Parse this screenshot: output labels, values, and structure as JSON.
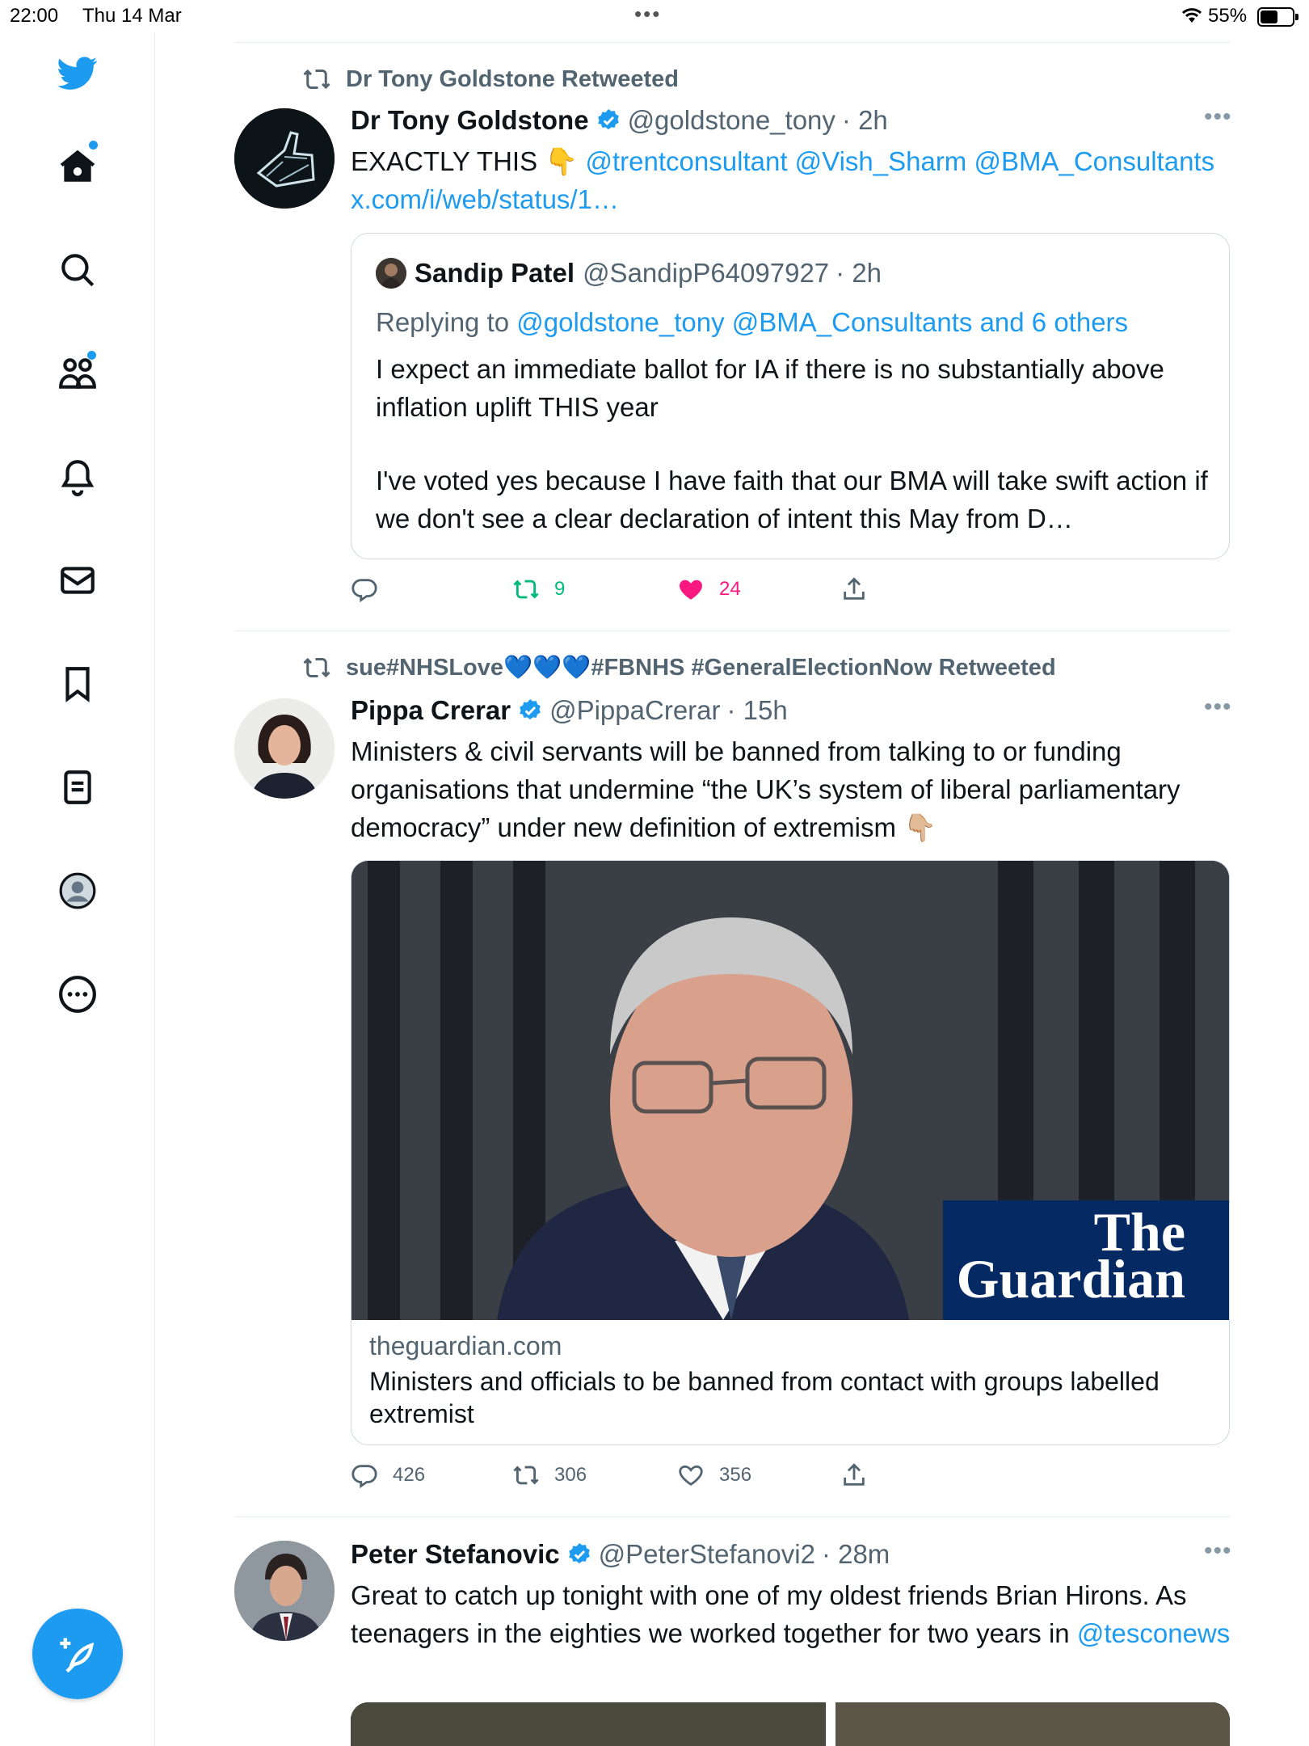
{
  "status_bar": {
    "time": "22:00",
    "date": "Thu 14 Mar",
    "battery": "55%",
    "battery_level": 0.55
  },
  "sidebar": {
    "items": [
      {
        "name": "home",
        "icon": "home-icon",
        "has_dot": true
      },
      {
        "name": "explore",
        "icon": "search-icon",
        "has_dot": false
      },
      {
        "name": "communities",
        "icon": "communities-icon",
        "has_dot": true
      },
      {
        "name": "notifications",
        "icon": "bell-icon",
        "has_dot": false
      },
      {
        "name": "messages",
        "icon": "envelope-icon",
        "has_dot": false
      },
      {
        "name": "bookmarks",
        "icon": "bookmark-icon",
        "has_dot": false
      },
      {
        "name": "lists",
        "icon": "list-icon",
        "has_dot": false
      },
      {
        "name": "profile",
        "icon": "avatar-icon",
        "has_dot": false
      },
      {
        "name": "more",
        "icon": "more-circle-icon",
        "has_dot": false
      }
    ],
    "compose_icon": "feather-plus-icon"
  },
  "tweets": [
    {
      "retweeted_by": "Dr Tony Goldstone Retweeted",
      "author": "Dr Tony Goldstone",
      "handle": "@goldstone_tony",
      "time": "· 2h",
      "text_plain": "EXACTLY THIS 👇 ",
      "text_links": "@trentconsultant @Vish_Sharm @BMA_Consultants",
      "url": "x.com/i/web/status/1…",
      "quote": {
        "author": "Sandip Patel",
        "handle": "@SandipP64097927",
        "time": "· 2h",
        "replying_label": "Replying to ",
        "replying_to": "@goldstone_tony @BMA_Consultants and 6 others",
        "para1": "I expect an immediate ballot for IA if there is no substantially above inflation uplift THIS year",
        "para2": "I've voted yes because I have faith that our BMA will take swift action if we don't see a clear declaration of intent this May from D…"
      },
      "actions": {
        "replies": "",
        "retweets": "9",
        "likes": "24"
      }
    },
    {
      "retweeted_by": "sue#NHSLove💙💙💙#FBNHS #GeneralElectionNow Retweeted",
      "author": "Pippa Crerar",
      "handle": "@PippaCrerar",
      "time": "· 15h",
      "text": "Ministers & civil servants will be banned from talking to or funding organisations that undermine “the UK’s system of liberal parliamentary democracy” under new definition of extremism 👇🏼",
      "card": {
        "image_logo_line1": "The",
        "image_logo_line2": "Guardian",
        "domain": "theguardian.com",
        "title": "Ministers and officials to be banned from contact with groups labelled extremist"
      },
      "actions": {
        "replies": "426",
        "retweets": "306",
        "likes": "356"
      }
    },
    {
      "author": "Peter Stefanovic",
      "handle": "@PeterStefanovi2",
      "time": "· 28m",
      "text": "Great to catch up tonight with one of my oldest friends Brian Hirons. As teenagers in the eighties we worked together for two years in ",
      "link": "@tesconews"
    }
  ],
  "colors": {
    "accent": "#1d9bf0",
    "retweet_green": "#00ba7c",
    "like_pink": "#f91880",
    "muted": "#536471",
    "guardian_blue": "#052962"
  }
}
